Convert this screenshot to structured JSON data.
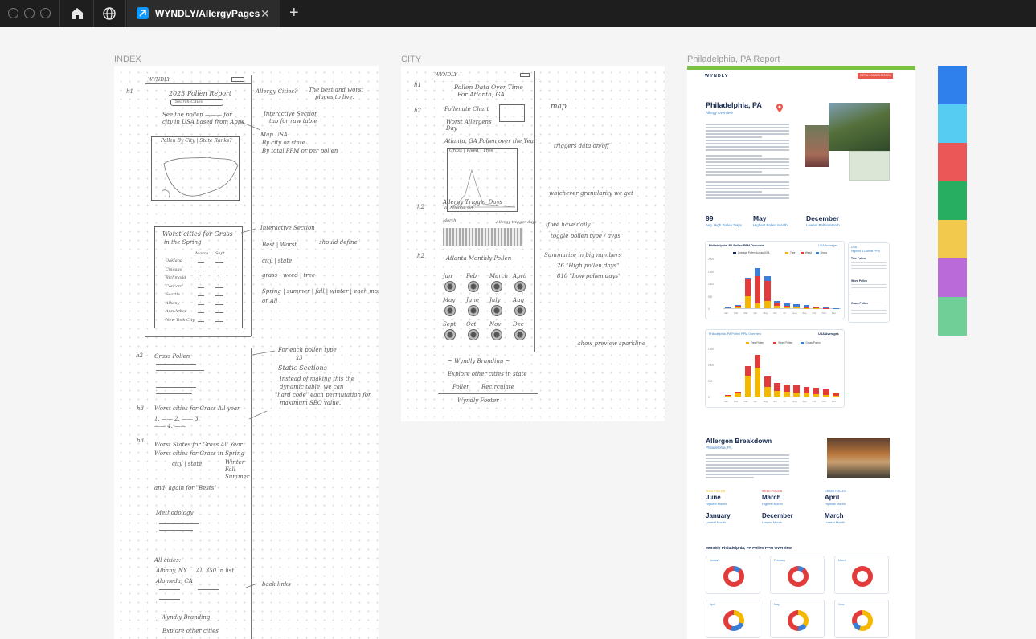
{
  "tabbar": {
    "file_tab": "WYNDLY/AllergyPages",
    "close_glyph": "✕",
    "new_tab_glyph": "+"
  },
  "frames": {
    "index_label": "INDEX",
    "city_label": "CITY",
    "report_label": "Philadelphia, PA Report"
  },
  "sketch_index": {
    "h1": "h1",
    "brand": "WYNDLY",
    "title": "2023 Pollen Report",
    "search": "Search Cities",
    "intro": "See the pollen ——— for",
    "intro2": "city in USA based from Apps",
    "allergy_cities": "Allergy Cities?",
    "best_worst": "The best and worst",
    "best_worst2": "places to live.",
    "interactive": "Interactive Section",
    "interactive2": "tab for raw table",
    "map_usa": "Map USA",
    "by_city": "By city or state",
    "by_total": "By total PPM or per pollen",
    "tabs_label": "Pollen By  City | State  Ranks?",
    "section_title": "Worst cities for Grass",
    "section_sub": "in the Spring",
    "col_march": "March",
    "col_sept": "Sept",
    "rows": [
      "Oakland",
      "Chicago",
      "Richmond",
      "Concord",
      "Seattle",
      "Albany",
      "Ann Arbor",
      "New York City"
    ],
    "interactive_b": "Interactive Section",
    "best_worst_b": "Best | Worst",
    "should_define": "should define",
    "city_state": "city | state",
    "grass_weed_tree": "grass | weed | tree",
    "seasons": "Spring | summer | fall | winter | each month +",
    "seasons2": "or All",
    "h2": "h2",
    "grass_pollen": "Grass Pollen",
    "for_each": "For each pollen type",
    "x3": "x3",
    "static_sections": "Static Sections",
    "instead_1": "Instead of making this the",
    "instead_2": "dynamic table, we can",
    "instead_3": "\"hard code\" each permutation for",
    "instead_4": "maximum SEO value.",
    "h3a": "h3",
    "worst_cities": "Worst cities for Grass All year",
    "list_123": "1. ——  2. ——  3. ——  4. ——",
    "h3b": "h3",
    "worst_states": "Worst States for Grass All Year",
    "worst_spring": "Worst cities for Grass in Spring",
    "city_state_b": "city | state",
    "winter": "Winter",
    "fall": "Fall",
    "summer": "Summer",
    "and_again": "and, again for \"Bests\"",
    "methodology": "Methodology",
    "all_cities": "All cities:",
    "albany": "Albany, NY",
    "alameda": "Alameda, CA",
    "all_350": "All 350 in list",
    "back_links": "back links",
    "branding": "~ Wyndly Branding ~",
    "explore": "Explore other cities"
  },
  "sketch_city": {
    "h1": "h1",
    "brand": "WYNDLY",
    "title1": "Pollen Data Over Time",
    "title2": "For Atlanta, GA",
    "h2": "h2",
    "stat1": "Pollenate Chart",
    "stat2": "Worst Allergens",
    "stat3": "Day",
    "map": "map",
    "chart_title": "Atlanta, GA Pollen over the Year",
    "toggle": "Grass | Weed | Tree",
    "triggers": "triggers data on/off",
    "trigger_days": "Allergy Trigger Days",
    "trigger_sub": "In Atlanta, GA",
    "whichever": "whichever granularity we get",
    "h2b": "h2",
    "legend_march": "March",
    "legend_days": "Allergy trigger days",
    "if_we": "if we have daily",
    "toggle2": "toggle pollen type / avgs",
    "h2c": "h2",
    "monthly": "Atlanta Monthly Pollen",
    "summarize": "Summarize in big numbers",
    "high_days": "26 \"High pollen days\"",
    "low_days": "810 \"Low pollen days\"",
    "months": [
      "Jan",
      "Feb",
      "March",
      "April",
      "May",
      "June",
      "July",
      "Aug",
      "Sept",
      "Oct",
      "Nov",
      "Dec"
    ],
    "show_preview": "show preview sparkline",
    "branding": "~ Wyndly Branding ~",
    "explore": "Explore other cities in state",
    "pollen": "Pollen",
    "recirculate": "Recirculate",
    "footer": "Wyndly Footer"
  },
  "report": {
    "brand": "WYNDLY",
    "nav_cta": "GET A CONSULTATION",
    "title": "Philadelphia, PA",
    "subtitle": "Allergy Overview",
    "big": [
      {
        "value": "99",
        "label": "Avg. High Pollen Days"
      },
      {
        "value": "May",
        "label": "Highest Pollen Month"
      },
      {
        "value": "December",
        "label": "Lowest Pollen Month"
      }
    ],
    "chart1_title": "Philadelphia, PA Pollen PPM Overview",
    "chart1_tab": "USA Averages",
    "chart1_legend": [
      "Average Pollen Across USA",
      "Tree",
      "Weed",
      "Grass"
    ],
    "side_title": "USA",
    "side_sub": "Highest & Lowest PPM",
    "side_sections": [
      "Tree Pollen",
      "Weed Pollen",
      "Grass Pollen"
    ],
    "chart2_title": "Philadelphia, PA Pollen PPM Overview",
    "chart2_tab": "USA Averages",
    "chart2_legend": [
      "Tree Pollen",
      "Weed Pollen",
      "Grass Pollen"
    ],
    "allergen_title": "Allergen Breakdown",
    "allergen_sub": "Philadelphia, PA",
    "allergen_groups": [
      {
        "type": "TREE POLLEN",
        "high": "June",
        "high_label": "Highest Month",
        "low": "January",
        "low_label": "Lowest Month"
      },
      {
        "type": "WEED POLLEN",
        "high": "March",
        "high_label": "Highest Month",
        "low": "December",
        "low_label": "Lowest Month"
      },
      {
        "type": "GRASS POLLEN",
        "high": "April",
        "high_label": "Highest Month",
        "low": "March",
        "low_label": "Lowest Month"
      }
    ],
    "monthly_title": "Monthly Philadelphia, PA Pollen PPM Overview",
    "donut_months": [
      "January",
      "February",
      "March",
      "April",
      "May",
      "June"
    ]
  },
  "colors": {
    "accent": "#0d99ff",
    "navy": "#14274e",
    "tree": "#f5b800",
    "weed": "#e23b3b",
    "grass": "#3a7fd5",
    "green_bar": "#7cc242",
    "swatches": [
      "#2f80ed",
      "#56ccf2",
      "#eb5757",
      "#27ae60",
      "#f2c94c",
      "#bb6bd9",
      "#6fcf97"
    ]
  },
  "chart_data": [
    {
      "type": "bar",
      "title": "Philadelphia, PA Pollen PPM Overview",
      "categories": [
        "Jan",
        "Feb",
        "Mar",
        "Apr",
        "May",
        "Jun",
        "Jul",
        "Aug",
        "Sep",
        "Oct",
        "Nov",
        "Dec"
      ],
      "ylim": [
        0,
        2000
      ],
      "series": [
        {
          "name": "Tree",
          "values": [
            20,
            80,
            500,
            200,
            300,
            100,
            40,
            20,
            10,
            5,
            5,
            5
          ]
        },
        {
          "name": "Weed",
          "values": [
            10,
            40,
            700,
            1100,
            800,
            80,
            60,
            60,
            50,
            30,
            10,
            5
          ]
        },
        {
          "name": "Grass",
          "values": [
            5,
            10,
            20,
            300,
            200,
            120,
            100,
            80,
            60,
            40,
            10,
            5
          ]
        }
      ]
    },
    {
      "type": "bar",
      "title": "Philadelphia, PA Pollen PPM Overview",
      "categories": [
        "Jan",
        "Feb",
        "Mar",
        "Apr",
        "May",
        "Jun",
        "Jul",
        "Aug",
        "Sep",
        "Oct",
        "Nov",
        "Dec"
      ],
      "ylim": [
        0,
        1500
      ],
      "series": [
        {
          "name": "Tree Pollen",
          "values": [
            30,
            100,
            650,
            900,
            300,
            180,
            150,
            120,
            90,
            80,
            60,
            30
          ]
        },
        {
          "name": "Weed Pollen",
          "values": [
            20,
            60,
            300,
            400,
            320,
            250,
            230,
            220,
            210,
            200,
            170,
            80
          ]
        },
        {
          "name": "Grass Pollen",
          "values": [
            0,
            0,
            0,
            0,
            0,
            0,
            0,
            0,
            0,
            0,
            0,
            0
          ]
        }
      ]
    }
  ]
}
